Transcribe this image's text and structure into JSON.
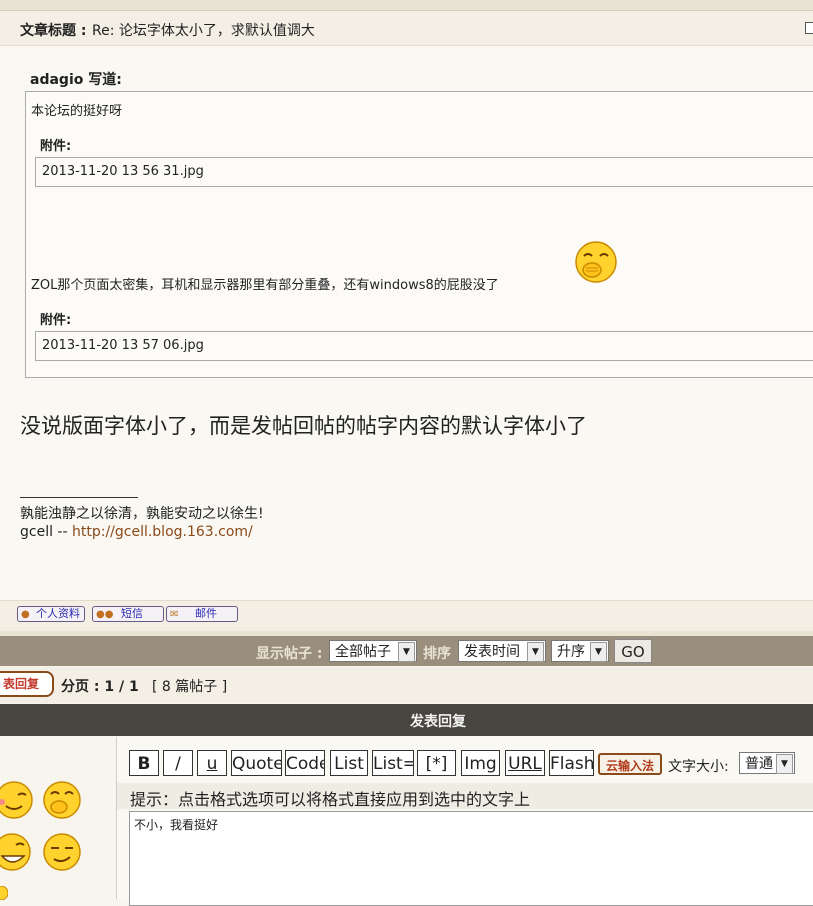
{
  "post": {
    "title_label": "文章标题 :",
    "title": "Re: 论坛字体太小了，求默认值调大",
    "quote_author": "adagio 写道:",
    "quote_line1": "本论坛的挺好呀",
    "attachment_label": "附件:",
    "attachment1": "2013-11-20 13 56 31.jpg",
    "quote_line2": "ZOL那个页面太密集，耳机和显示器那里有部分重叠，还有windows8的屁股没了",
    "attachment2": "2013-11-20 13 57 06.jpg",
    "body": "没说版面字体小了，而是发帖回帖的帖字内容的默认字体小了",
    "signature_line1": "孰能浊静之以徐清，孰能安动之以徐生!",
    "signature_prefix": "gcell -- ",
    "signature_link": "http://gcell.blog.163.com/"
  },
  "profile_buttons": {
    "profile": "个人资料",
    "message": "短信",
    "email": "邮件"
  },
  "filter": {
    "show_label": "显示帖子 :",
    "show_value": "全部帖子",
    "sort_label": "排序",
    "sort_value": "发表时间",
    "order_value": "升序",
    "go": "GO"
  },
  "pagination": {
    "reply_button": "表回复",
    "page_label": "分页 :",
    "page_value": "1 / 1",
    "count": "[ 8 篇帖子 ]"
  },
  "reply": {
    "header": "发表回复",
    "toolbar": [
      "B",
      "/",
      "u",
      "Quote",
      "Code",
      "List",
      "List=",
      "[*]",
      "Img",
      "URL",
      "Flash"
    ],
    "cloud_input": "云输入法",
    "font_size_label": "文字大小:",
    "font_size_value": "普通",
    "hint": "提示：点击格式选项可以将格式直接应用到选中的文字上",
    "text": "不小，我看挺好"
  },
  "colors": {
    "accent": "#8a4a1a",
    "header_dark": "#48443e",
    "filter_bar": "#9a8e7c"
  }
}
